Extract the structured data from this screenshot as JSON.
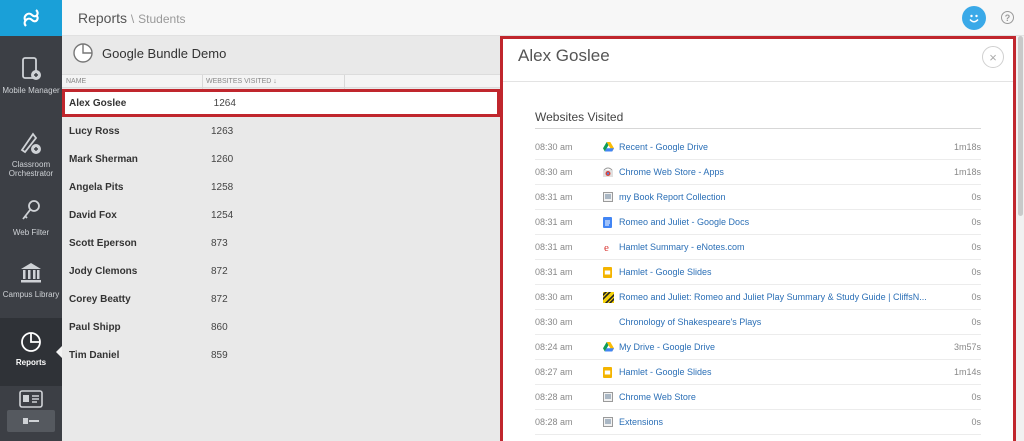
{
  "header": {
    "section": "Reports",
    "separator": "\\",
    "subsection": "Students"
  },
  "sidebar": {
    "items": [
      {
        "label": "Mobile Manager",
        "icon": "mobile-manager-icon"
      },
      {
        "label": "Classroom Orchestrator",
        "icon": "classroom-orchestrator-icon"
      },
      {
        "label": "Web Filter",
        "icon": "key-icon"
      },
      {
        "label": "Campus Library",
        "icon": "library-icon"
      },
      {
        "label": "Reports",
        "icon": "pie-chart-icon",
        "active": true
      }
    ]
  },
  "list": {
    "title": "Google Bundle Demo",
    "columns": {
      "name": "NAME",
      "visited": "WEBSITES VISITED ↓"
    },
    "rows": [
      {
        "name": "Alex Goslee",
        "visited": "1264"
      },
      {
        "name": "Lucy Ross",
        "visited": "1263"
      },
      {
        "name": "Mark Sherman",
        "visited": "1260"
      },
      {
        "name": "Angela Pits",
        "visited": "1258"
      },
      {
        "name": "David Fox",
        "visited": "1254"
      },
      {
        "name": "Scott Eperson",
        "visited": "873"
      },
      {
        "name": "Jody Clemons",
        "visited": "872"
      },
      {
        "name": "Corey Beatty",
        "visited": "872"
      },
      {
        "name": "Paul Shipp",
        "visited": "860"
      },
      {
        "name": "Tim Daniel",
        "visited": "859"
      }
    ]
  },
  "detail": {
    "name": "Alex Goslee",
    "section_title": "Websites Visited",
    "close": "×",
    "sites": [
      {
        "time": "08:30 am",
        "icon": "drive-icon",
        "title": "Recent - Google Drive",
        "duration": "1m18s"
      },
      {
        "time": "08:30 am",
        "icon": "webstore-icon",
        "title": "Chrome Web Store - Apps",
        "duration": "1m18s"
      },
      {
        "time": "08:31 am",
        "icon": "page-icon",
        "title": "my Book Report Collection",
        "duration": "0s"
      },
      {
        "time": "08:31 am",
        "icon": "docs-icon",
        "title": "Romeo and Juliet - Google Docs",
        "duration": "0s"
      },
      {
        "time": "08:31 am",
        "icon": "enotes-icon",
        "title": "Hamlet Summary - eNotes.com",
        "duration": "0s"
      },
      {
        "time": "08:31 am",
        "icon": "slides-icon",
        "title": "Hamlet - Google Slides",
        "duration": "0s"
      },
      {
        "time": "08:30 am",
        "icon": "cliffsnotes-icon",
        "title": "Romeo and Juliet: Romeo and Juliet Play Summary & Study Guide | CliffsN...",
        "duration": "0s"
      },
      {
        "time": "08:30 am",
        "icon": "",
        "title": "Chronology of Shakespeare's Plays",
        "duration": "0s"
      },
      {
        "time": "08:24 am",
        "icon": "drive-icon",
        "title": "My Drive - Google Drive",
        "duration": "3m57s"
      },
      {
        "time": "08:27 am",
        "icon": "slides-icon",
        "title": "Hamlet - Google Slides",
        "duration": "1m14s"
      },
      {
        "time": "08:28 am",
        "icon": "page-icon",
        "title": "Chrome Web Store",
        "duration": "0s"
      },
      {
        "time": "08:28 am",
        "icon": "page-icon",
        "title": "Extensions",
        "duration": "0s"
      }
    ]
  },
  "colors": {
    "sidebar": "#3c3f45",
    "logo": "#1aa0d8",
    "highlight": "#c0262d",
    "link": "#2b6fb6"
  }
}
